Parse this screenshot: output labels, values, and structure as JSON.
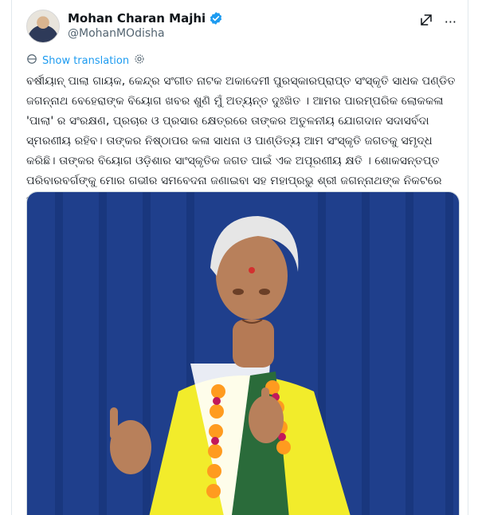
{
  "author": {
    "display_name": "Mohan Charan Majhi",
    "handle": "@MohanMOdisha"
  },
  "actions": {
    "grok_icon": "grok-icon",
    "more_icon": "more-icon"
  },
  "translate": {
    "label": "Show translation"
  },
  "post": {
    "text": "ବର୍ଷୀୟାନ୍ ପାଲା ଗାୟକ, କେନ୍ଦ୍ର ସଂଗୀତ ନାଟକ ଅକାଦେମୀ ପୁରସ୍କାରପ୍ରାପ୍ତ ସଂସ୍କୃତି ସାଧକ ପଣ୍ଡିତ ଜଗନ୍ନାଥ ବେହେରାଙ୍କ ବିୟୋଗ ଖବର ଶୁଣି ମୁଁ ଅତ୍ୟନ୍ତ ଦୁଃଖିତ । ଆମର ପାରମ୍ପରିକ ଲୋକକଳା 'ପାଲା' ର ସଂରକ୍ଷଣ, ପ୍ରଚାର ଓ ପ୍ରସାର କ୍ଷେତ୍ରରେ ତାଙ୍କର ଅତୁଳନୀୟ ଯୋଗଦାନ ସଦାସର୍ବଦା ସ୍ମରଣୀୟ ରହିବ। ତାଙ୍କର ନିଷ୍ଠାପର କଳା ସାଧନା ଓ ପାଣ୍ଡିତ୍ୟ ଆମ ସଂସ୍କୃତି ଜଗତକୁ ସମୃଦ୍ଧ କରିଛି। ତାଙ୍କର ବିୟୋଗ ଓଡ଼ିଶାର ସାଂସ୍କୃତିକ ଜଗତ ପାଇଁ ଏକ ଅପୂରଣୀୟ କ୍ଷତି । ଶୋକସନ୍ତପ୍ତ ପରିବାରବର୍ଗଙ୍କୁ ମୋର ଗଭୀର ସମବେଦନା ଜଣାଇବା ସହ ମହାପ୍ରଭୁ ଶ୍ରୀ ଜଗନ୍ନାଥଙ୍କ ନିକଟରେ ଅମର ଆତ୍ମାର ସଦ୍ଗତି କାମନା କରୁଛି। ଓମ୍ ଶାନ୍ତି 🙏"
  },
  "colors": {
    "accent": "#1d9bf0",
    "curtain": "#1f3f8c",
    "shirt": "#f4ef2e"
  }
}
